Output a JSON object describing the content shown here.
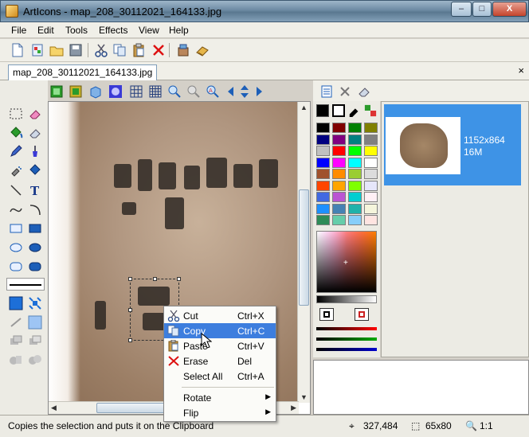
{
  "window": {
    "title": "ArtIcons - map_208_30112021_164133.jpg"
  },
  "menubar": [
    "File",
    "Edit",
    "Tools",
    "Effects",
    "View",
    "Help"
  ],
  "toolbar": {
    "icons": [
      "new-document-icon",
      "new-from-clipboard-icon",
      "open-folder-icon",
      "save-icon",
      "cut-icon",
      "copy-icon",
      "paste-icon",
      "delete-icon",
      "library-icon",
      "book-icon"
    ]
  },
  "tab": {
    "label": "map_208_30112021_164133.jpg",
    "close": "×"
  },
  "layers": {
    "size": "1152x864",
    "depth": "16M"
  },
  "context_menu": {
    "items": [
      {
        "label": "Cut",
        "shortcut": "Ctrl+X",
        "icon": "cut-icon"
      },
      {
        "label": "Copy",
        "shortcut": "Ctrl+C",
        "icon": "copy-icon",
        "highlighted": true
      },
      {
        "label": "Paste",
        "shortcut": "Ctrl+V",
        "icon": "paste-icon"
      },
      {
        "label": "Erase",
        "shortcut": "Del",
        "icon": "erase-icon"
      },
      {
        "label": "Select All",
        "shortcut": "Ctrl+A",
        "icon": ""
      },
      {
        "label": "Rotate",
        "shortcut": "",
        "icon": "",
        "submenu": true
      },
      {
        "label": "Flip",
        "shortcut": "",
        "icon": "",
        "submenu": true
      }
    ]
  },
  "status": {
    "text": "Copies the selection and puts it on the Clipboard",
    "coords": "327,484",
    "size": "65x80",
    "zoom": "1:1"
  },
  "palette": {
    "colors": [
      "#000000",
      "#800000",
      "#008000",
      "#808000",
      "#000080",
      "#800080",
      "#008080",
      "#808080",
      "#c0c0c0",
      "#ff0000",
      "#00ff00",
      "#ffff00",
      "#0000ff",
      "#ff00ff",
      "#00ffff",
      "#ffffff",
      "#a0522d",
      "#ff8c00",
      "#9acd32",
      "#dcdcdc",
      "#ff4500",
      "#ffa500",
      "#7fff00",
      "#e6e6fa",
      "#4169e1",
      "#ba55d3",
      "#00ced1",
      "#fff0f5",
      "#1e90ff",
      "#4682b4",
      "#20b2aa",
      "#f5f5dc",
      "#2e8b57",
      "#66cdaa",
      "#87cefa",
      "#ffe4e1"
    ]
  },
  "accent": "#3e93e6"
}
